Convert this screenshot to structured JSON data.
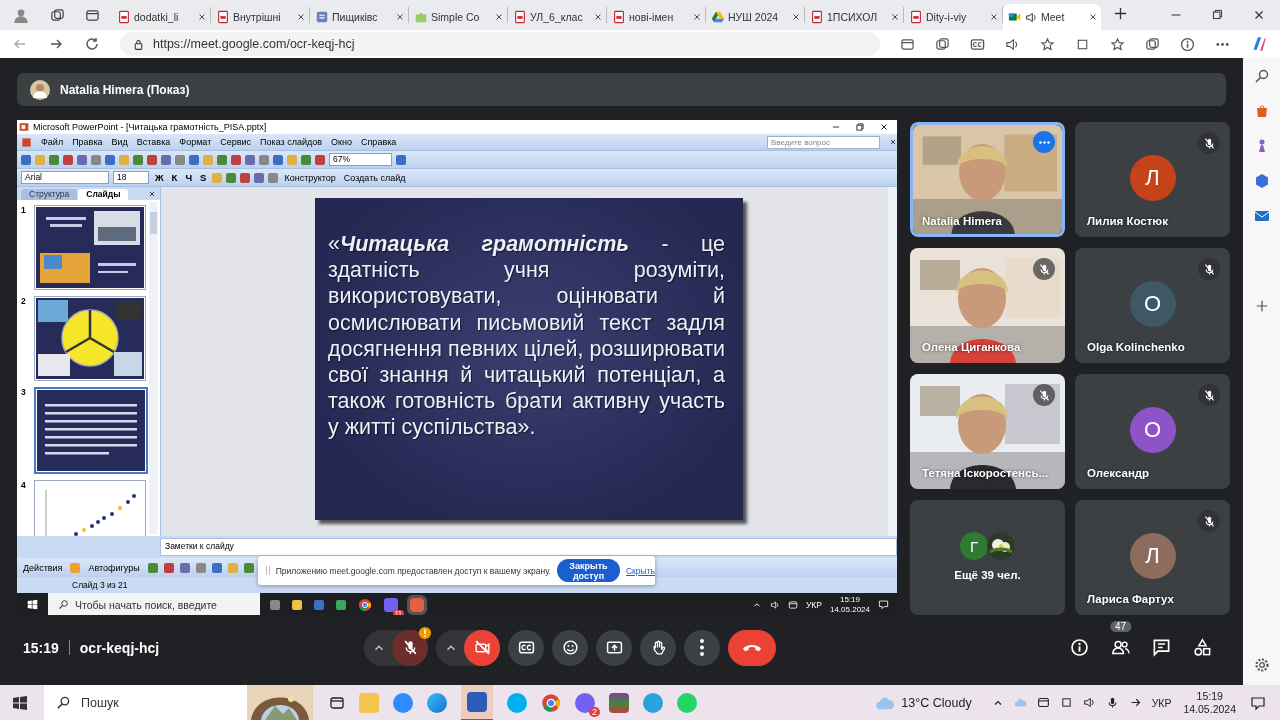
{
  "browser": {
    "tabs": [
      {
        "label": "dodatki_li",
        "kind": "pdf",
        "selected": false,
        "audio": false
      },
      {
        "label": "Внутрішні",
        "kind": "pdf",
        "selected": false,
        "audio": false
      },
      {
        "label": "Пищиківс",
        "kind": "form",
        "selected": false,
        "audio": false
      },
      {
        "label": "Simple Co",
        "kind": "puzzle",
        "selected": false,
        "audio": false
      },
      {
        "label": "УЛ_6_клас",
        "kind": "pdf",
        "selected": false,
        "audio": false
      },
      {
        "label": "нові-імен",
        "kind": "pdf",
        "selected": false,
        "audio": false
      },
      {
        "label": "НУШ 2024",
        "kind": "drive",
        "selected": false,
        "audio": false
      },
      {
        "label": "1ПСИХОЛ",
        "kind": "pdf",
        "selected": false,
        "audio": false
      },
      {
        "label": "Dity-i-viy",
        "kind": "pdf",
        "selected": false,
        "audio": false
      },
      {
        "label": "Meet",
        "kind": "meet",
        "selected": true,
        "audio": true
      }
    ],
    "url": "https://meet.google.com/ocr-keqj-hcj"
  },
  "meeting": {
    "presenter": "Natalia Himera (Показ)",
    "powerpoint": {
      "title": "Microsoft PowerPoint - [Читацька грамотність_PISA.pptx]",
      "menu": [
        "Файл",
        "Правка",
        "Вид",
        "Вставка",
        "Формат",
        "Сервис",
        "Показ слайдов",
        "Окно",
        "Справка"
      ],
      "help_placeholder": "Введите вопрос",
      "zoom": "67%",
      "font": "Arial",
      "font_size": "18",
      "format_buttons": [
        "Ж",
        "К",
        "Ч",
        "S"
      ],
      "design_button": "Конструктор",
      "new_slide_button": "Создать слайд",
      "panel_tabs": [
        {
          "label": "Структура",
          "selected": false
        },
        {
          "label": "Слайды",
          "selected": true
        }
      ],
      "slides": [
        {
          "number": "1",
          "kind": "title",
          "selected": false
        },
        {
          "number": "2",
          "kind": "diagram",
          "selected": false
        },
        {
          "number": "3",
          "kind": "text",
          "selected": true
        },
        {
          "number": "4",
          "kind": "chart",
          "selected": false
        }
      ],
      "slide_text": "«**Читацька грамотність** - це здатність учня розуміти, використовувати, оцінювати й осмислювати письмовий текст задля досягнення певних цілей, розширювати свої знання й читацький потенціал, а також готовність брати активну участь у житті суспільства».",
      "notes_placeholder": "Заметки к слайду",
      "actions_menu": "Действия",
      "autoshapes_menu": "Автофигуры",
      "status": "Слайд 3 из 21"
    },
    "share_notice": {
      "text": "Приложению meet.google.com предоставлен доступ к вашему экрану.",
      "button": "Закрыть доступ",
      "link": "Скрыть"
    },
    "remote_taskbar": {
      "search_placeholder": "Чтобы начать поиск, введите",
      "badge": "11",
      "language": "УКР",
      "time": "15:19",
      "date": "14.05.2024"
    },
    "participants": [
      {
        "name": "Natalia Himera",
        "kind": "video",
        "muted": false,
        "highlighted": true
      },
      {
        "name": "Лилия Костюк",
        "kind": "avatar",
        "initial": "Л",
        "color": "#c5421b",
        "muted": true,
        "highlighted": false
      },
      {
        "name": "Олена Циганкова",
        "kind": "video",
        "muted": true,
        "highlighted": false
      },
      {
        "name": "Olga Kolinchenko",
        "kind": "avatar",
        "initial": "O",
        "color": "#3e5866",
        "muted": true,
        "highlighted": false
      },
      {
        "name": "Тетяна Іскоростенсь...",
        "kind": "video",
        "muted": true,
        "highlighted": false
      },
      {
        "name": "Олександр",
        "kind": "avatar",
        "initial": "O",
        "color": "#8e52c9",
        "muted": true,
        "highlighted": false
      },
      {
        "name": "Лариса Фартух",
        "kind": "avatar",
        "initial": "Л",
        "color": "#8d6b5d",
        "muted": true,
        "highlighted": false
      }
    ],
    "more": {
      "initial": "Г",
      "color": "#2e7a32",
      "label": "Ещё 39 чел."
    },
    "bar": {
      "time": "15:19",
      "code": "ocr-keqj-hcj",
      "mic_on": false,
      "camera_on": false,
      "people_count": "47"
    }
  },
  "taskbar": {
    "search_placeholder": "Пошук",
    "badge": "2",
    "weather": "13°C Cloudy",
    "language": "УКР",
    "time": "15:19",
    "date": "14.05.2024"
  }
}
